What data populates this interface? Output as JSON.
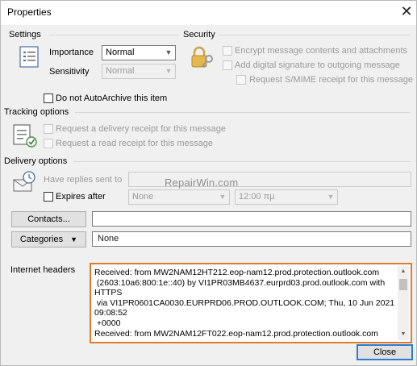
{
  "window": {
    "title": "Properties",
    "close_glyph": "✕"
  },
  "settings": {
    "section_label": "Settings",
    "importance_label": "Importance",
    "importance_value": "Normal",
    "sensitivity_label": "Sensitivity",
    "sensitivity_value": "Normal",
    "autoarchive_label": "Do not AutoArchive this item",
    "icon": "message-settings-icon"
  },
  "security": {
    "section_label": "Security",
    "encrypt_label": "Encrypt message contents and attachments",
    "signature_label": "Add digital signature to outgoing message",
    "smime_label": "Request S/MIME receipt for this message",
    "icon": "lock-key-icon"
  },
  "tracking": {
    "section_label": "Tracking options",
    "delivery_receipt_label": "Request a delivery receipt for this message",
    "read_receipt_label": "Request a read receipt for this message",
    "icon": "tracking-check-icon"
  },
  "delivery": {
    "section_label": "Delivery options",
    "replies_label": "Have replies sent to",
    "replies_value": "",
    "expires_label": "Expires after",
    "expires_date": "None",
    "expires_time": "12:00 πμ",
    "icon": "delivery-icon"
  },
  "contacts": {
    "button_label": "Contacts...",
    "value": ""
  },
  "categories": {
    "button_label": "Categories",
    "value": "None"
  },
  "internet_headers": {
    "label": "Internet headers",
    "text": "Received: from MW2NAM12HT212.eop-nam12.prod.protection.outlook.com\n (2603:10a6:800:1e::40) by VI1PR03MB4637.eurprd03.prod.outlook.com with\nHTTPS\n via VI1PR0601CA0030.EURPRD06.PROD.OUTLOOK.COM; Thu, 10 Jun 2021\n09:08:52\n +0000\nReceived: from MW2NAM12FT022.eop-nam12.prod.protection.outlook.com"
  },
  "close_button_label": "Close",
  "watermark": "RepairWin.com",
  "colors": {
    "highlight_border": "#e07b2c",
    "default_button_border": "#2b7cd3"
  }
}
